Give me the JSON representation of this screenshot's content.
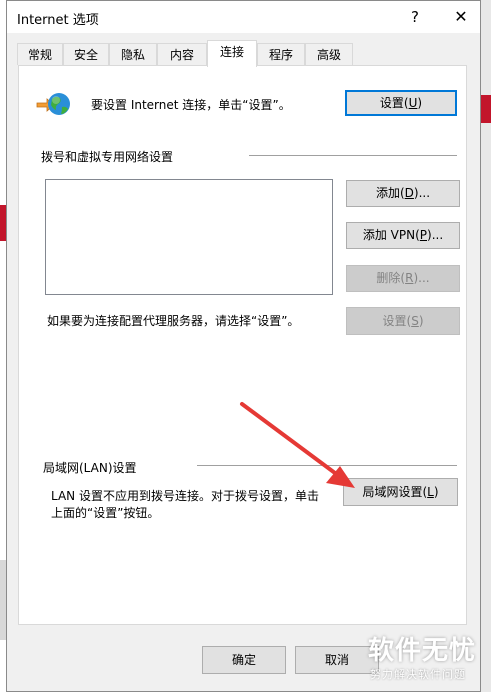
{
  "window": {
    "title": "Internet 选项",
    "help_glyph": "?",
    "close_glyph": "✕"
  },
  "tabs": [
    {
      "label": "常规",
      "active": false
    },
    {
      "label": "安全",
      "active": false
    },
    {
      "label": "隐私",
      "active": false
    },
    {
      "label": "内容",
      "active": false
    },
    {
      "label": "连接",
      "active": true
    },
    {
      "label": "程序",
      "active": false
    },
    {
      "label": "高级",
      "active": false
    }
  ],
  "setup": {
    "icon": "internet-globe-icon",
    "text": "要设置 Internet 连接，单击“设置”。",
    "button": {
      "text": "设置(",
      "key": "U",
      "suffix": ")"
    }
  },
  "dialup": {
    "heading": "拨号和虚拟专用网络设置",
    "add_button": {
      "text": "添加(",
      "key": "D",
      "suffix": ")..."
    },
    "add_vpn_button": {
      "text": "添加 VPN(",
      "key": "P",
      "suffix": ")..."
    },
    "delete_button": {
      "text": "删除(",
      "key": "R",
      "suffix": ")..."
    },
    "proxy_text": "如果要为连接配置代理服务器，请选择“设置”。",
    "settings_button": {
      "text": "设置(",
      "key": "S",
      "suffix": ")"
    }
  },
  "lan": {
    "heading": "局域网(LAN)设置",
    "description_line1": "LAN 设置不应用到拨号连接。对于拨号设置，单击",
    "description_line2": "上面的“设置”按钮。",
    "button": {
      "text": "局域网设置(",
      "key": "L",
      "suffix": ")"
    }
  },
  "footer": {
    "ok_label": "确定",
    "cancel_label": "取消"
  },
  "watermark": {
    "title": "软件无忧",
    "subtitle": "努力解决软件问题"
  },
  "colors": {
    "annotation_arrow": "#e53935",
    "focus_border": "#0078d7",
    "watermark_text": "#ffffff"
  }
}
